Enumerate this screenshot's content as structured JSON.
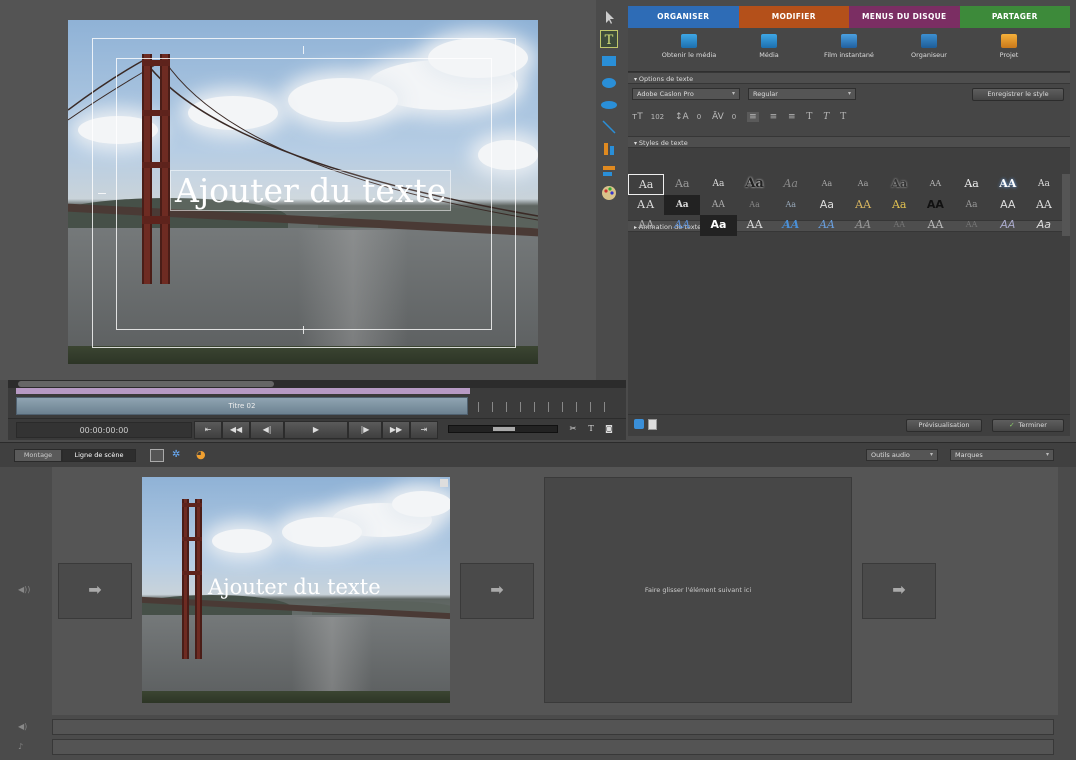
{
  "tabs": [
    {
      "label": "ORGANISER",
      "color": "#2e6cb6"
    },
    {
      "label": "MODIFIER",
      "color": "#b4501a"
    },
    {
      "label": "MENUS DU DISQUE",
      "color": "#7b2e63"
    },
    {
      "label": "PARTAGER",
      "color": "#3d8a3a"
    }
  ],
  "toolbar": [
    {
      "label": "Obtenir le média",
      "icon": "get-media-icon"
    },
    {
      "label": "Média",
      "icon": "media-icon"
    },
    {
      "label": "Film instantané",
      "icon": "instant-movie-icon"
    },
    {
      "label": "Organiseur",
      "icon": "organizer-icon"
    },
    {
      "label": "Projet",
      "icon": "project-icon"
    }
  ],
  "text_options": {
    "header": "Options de texte",
    "font": "Adobe Caslon Pro",
    "weight": "Regular",
    "save_style": "Enregistrer le style",
    "size": "102",
    "leading": "0",
    "kerning": "0"
  },
  "text_styles": {
    "header": "Styles de texte",
    "samples": [
      "Aa",
      "Aa",
      "Aa",
      "Aa",
      "Aa",
      "Aa",
      "Aa",
      "Aa",
      "AA",
      "Aa",
      "AA",
      "Aa",
      "AA",
      "Aa",
      "AA",
      "Aa",
      "Aa",
      "Aa",
      "AA",
      "Aa",
      "AA",
      "Aa",
      "AA",
      "AA",
      "AA",
      "AA",
      "Aa",
      "AA",
      "AA",
      "AA",
      "AA",
      "AA",
      "AA",
      "AA",
      "AA",
      "Aa"
    ]
  },
  "animation_header": "Animation de texte",
  "preview_button": "Prévisualisation",
  "done_button": "Terminer",
  "monitor": {
    "overlay_text": "Ajouter du texte",
    "clip_title": "Titre 02",
    "timecode": "00:00:00:00"
  },
  "lower": {
    "tab_montage": "Montage",
    "tab_scene": "Ligne de scène",
    "audio_tools": "Outils audio",
    "markers": "Marques",
    "drop_hint": "Faire glisser l'élément suivant ici",
    "thumb_text": "Ajouter du texte"
  }
}
